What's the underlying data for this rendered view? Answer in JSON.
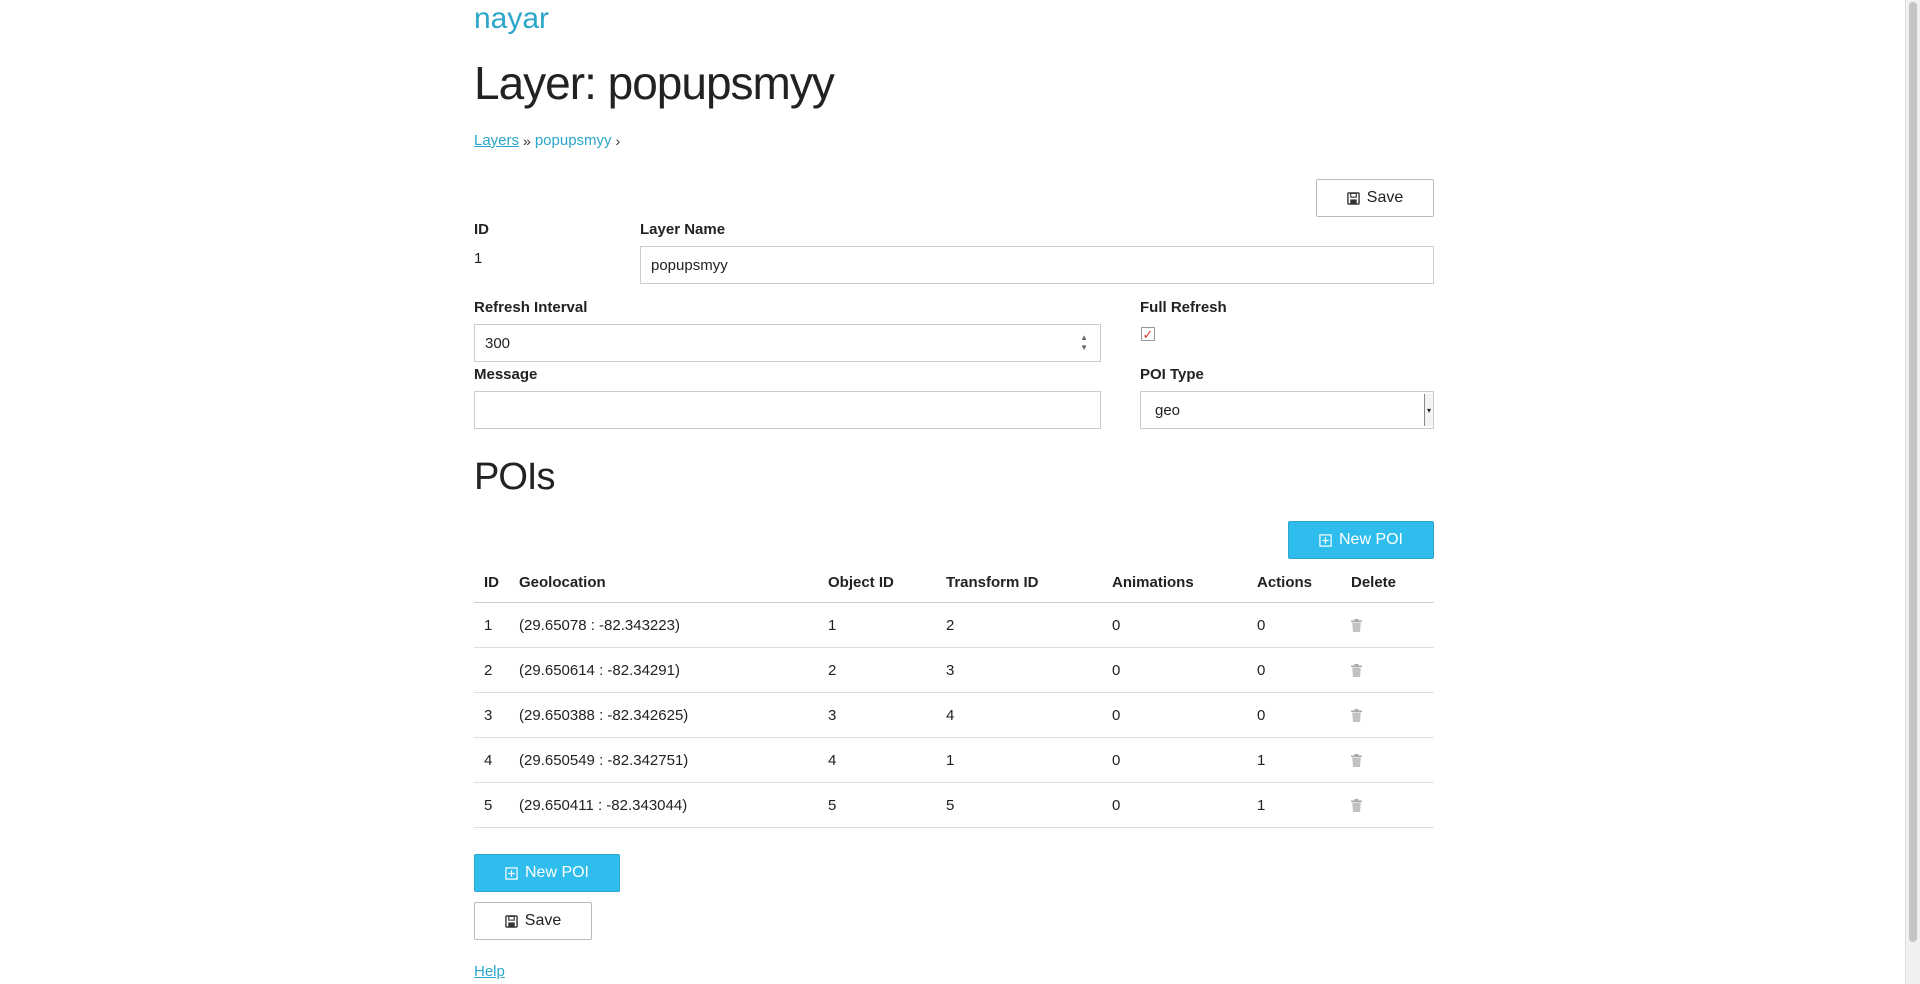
{
  "app": {
    "brand": "nayar"
  },
  "page": {
    "title": "Layer: popupsmyy"
  },
  "breadcrumb": {
    "root": "Layers",
    "sep": "»",
    "current": "popupsmyy",
    "tail": "›"
  },
  "toolbar": {
    "save_label": "Save"
  },
  "form": {
    "id_label": "ID",
    "id_value": "1",
    "layer_name_label": "Layer Name",
    "layer_name_value": "popupsmyy",
    "refresh_interval_label": "Refresh Interval",
    "refresh_interval_value": "300",
    "full_refresh_label": "Full Refresh",
    "full_refresh_checked": true,
    "message_label": "Message",
    "message_value": "",
    "poi_type_label": "POI Type",
    "poi_type_value": "geo"
  },
  "pois": {
    "title": "POIs",
    "new_label": "New POI",
    "columns": [
      "ID",
      "Geolocation",
      "Object ID",
      "Transform ID",
      "Animations",
      "Actions",
      "Delete"
    ],
    "rows": [
      {
        "id": "1",
        "geolocation": "(29.65078 : -82.343223)",
        "object_id": "1",
        "transform_id": "2",
        "animations": "0",
        "actions": "0"
      },
      {
        "id": "2",
        "geolocation": "(29.650614 : -82.34291)",
        "object_id": "2",
        "transform_id": "3",
        "animations": "0",
        "actions": "0"
      },
      {
        "id": "3",
        "geolocation": "(29.650388 : -82.342625)",
        "object_id": "3",
        "transform_id": "4",
        "animations": "0",
        "actions": "0"
      },
      {
        "id": "4",
        "geolocation": "(29.650549 : -82.342751)",
        "object_id": "4",
        "transform_id": "1",
        "animations": "0",
        "actions": "1"
      },
      {
        "id": "5",
        "geolocation": "(29.650411 : -82.343044)",
        "object_id": "5",
        "transform_id": "5",
        "animations": "0",
        "actions": "1"
      }
    ]
  },
  "footer": {
    "new_poi_label": "New POI",
    "save_label": "Save",
    "help_label": "Help"
  },
  "colors": {
    "accent": "#2ba6cb",
    "primary_button": "#2ebdec",
    "check": "#dd3333"
  },
  "icons": {
    "save": "floppy-disk-icon",
    "new": "plus-square-icon",
    "delete": "trash-icon"
  }
}
